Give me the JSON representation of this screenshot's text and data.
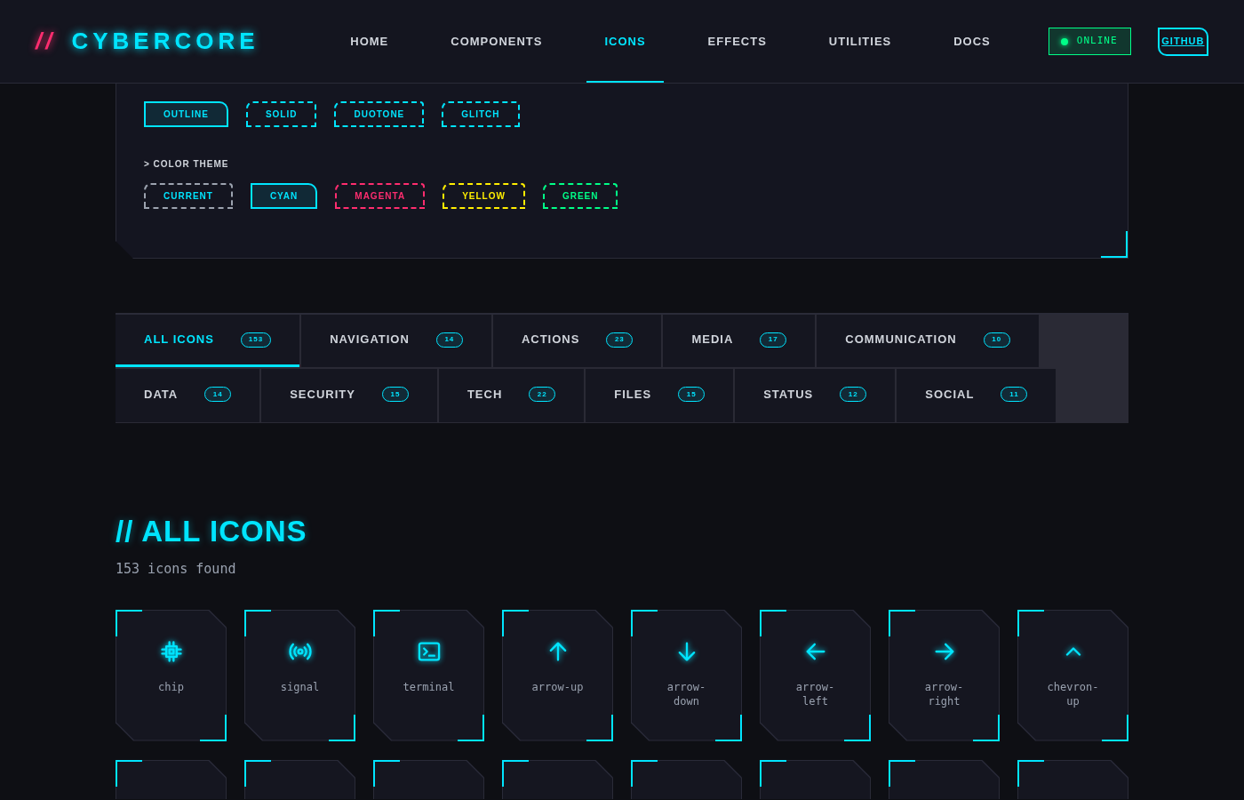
{
  "logo": {
    "prefix": "//",
    "name": "CYBERCORE"
  },
  "nav": [
    {
      "label": "HOME",
      "selected": false
    },
    {
      "label": "COMPONENTS",
      "selected": false
    },
    {
      "label": "ICONS",
      "selected": true
    },
    {
      "label": "EFFECTS",
      "selected": false
    },
    {
      "label": "UTILITIES",
      "selected": false
    },
    {
      "label": "DOCS",
      "selected": false
    }
  ],
  "status": {
    "label": "ONLINE",
    "on": true
  },
  "github": "GITHUB",
  "variants": [
    {
      "label": "OUTLINE",
      "selected": true
    },
    {
      "label": "SOLID",
      "selected": false
    },
    {
      "label": "DUOTONE",
      "selected": false
    },
    {
      "label": "GLITCH",
      "selected": false
    }
  ],
  "color_theme": {
    "heading": "> COLOR THEME",
    "options": [
      {
        "label": "CURRENT",
        "selected": false,
        "color": "#9ca3af"
      },
      {
        "label": "CYAN",
        "selected": true,
        "color": "#00e5ff"
      },
      {
        "label": "MAGENTA",
        "selected": false,
        "color": "#ff2d6f"
      },
      {
        "label": "YELLOW",
        "selected": false,
        "color": "#ffee00"
      },
      {
        "label": "GREEN",
        "selected": false,
        "color": "#00ff88"
      }
    ]
  },
  "category_rows": [
    [
      {
        "label": "ALL ICONS",
        "count": "153",
        "selected": true
      },
      {
        "label": "NAVIGATION",
        "count": "14",
        "selected": false
      },
      {
        "label": "ACTIONS",
        "count": "23",
        "selected": false
      },
      {
        "label": "MEDIA",
        "count": "17",
        "selected": false
      },
      {
        "label": "COMMUNICATION",
        "count": "10",
        "selected": false
      }
    ],
    [
      {
        "label": "DATA",
        "count": "14",
        "selected": false
      },
      {
        "label": "SECURITY",
        "count": "15",
        "selected": false
      },
      {
        "label": "TECH",
        "count": "22",
        "selected": false
      },
      {
        "label": "FILES",
        "count": "15",
        "selected": false
      },
      {
        "label": "STATUS",
        "count": "12",
        "selected": false
      },
      {
        "label": "SOCIAL",
        "count": "11",
        "selected": false
      }
    ]
  ],
  "section": {
    "title": "// ALL ICONS",
    "summary": "153 icons found"
  },
  "icons": [
    {
      "kind": "chip",
      "label": "chip"
    },
    {
      "kind": "signal",
      "label": "signal"
    },
    {
      "kind": "terminal",
      "label": "terminal"
    },
    {
      "kind": "arrow-up",
      "label": "arrow-up"
    },
    {
      "kind": "arrow-down",
      "label": "arrow-\ndown"
    },
    {
      "kind": "arrow-left",
      "label": "arrow-\nleft"
    },
    {
      "kind": "arrow-right",
      "label": "arrow-\nright"
    },
    {
      "kind": "chevron-up",
      "label": "chevron-\nup"
    }
  ]
}
